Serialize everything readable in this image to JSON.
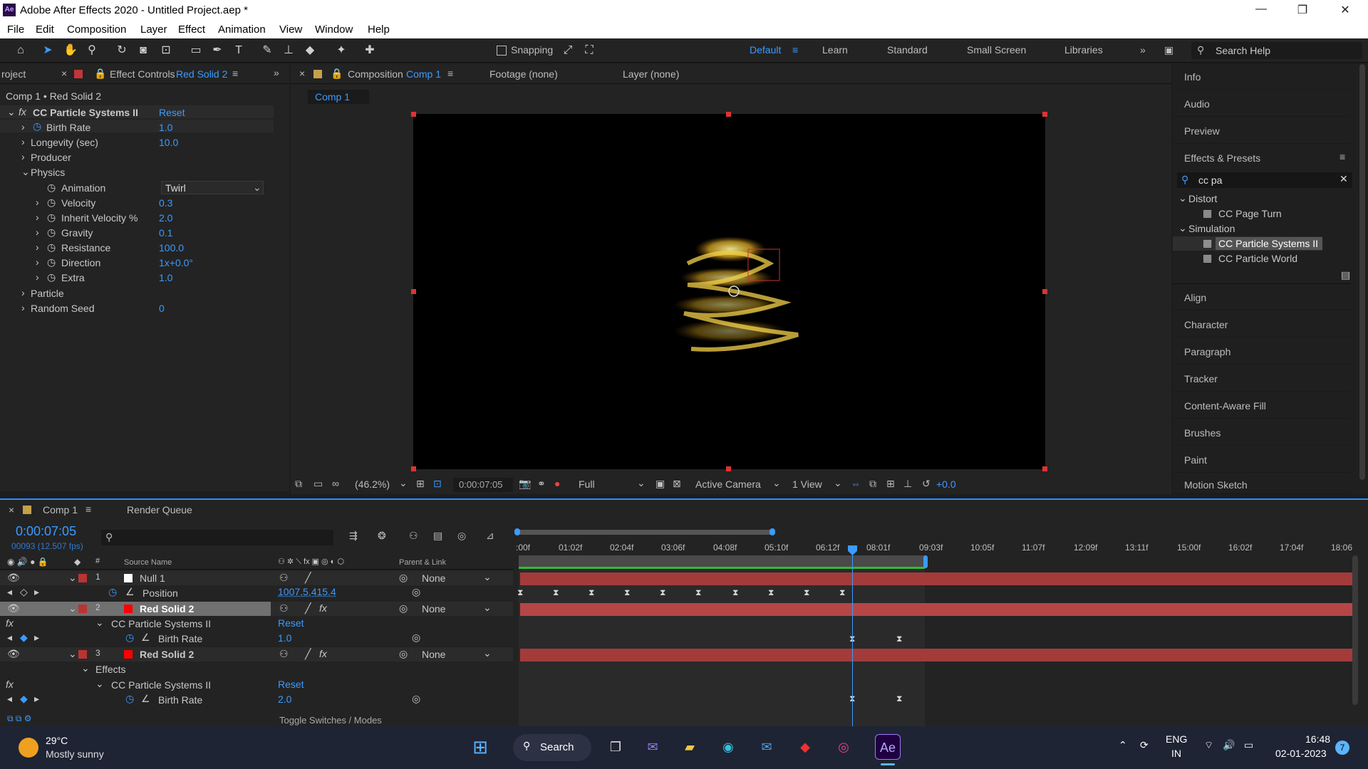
{
  "app": {
    "title": "Adobe After Effects 2020 - Untitled Project.aep *",
    "icon": "Ae"
  },
  "window_controls": [
    "—",
    "❐",
    "✕"
  ],
  "menu": [
    "File",
    "Edit",
    "Composition",
    "Layer",
    "Effect",
    "Animation",
    "View",
    "Window",
    "Help"
  ],
  "toolbar": {
    "snapping": "Snapping",
    "workspaces": [
      "Default",
      "Learn",
      "Standard",
      "Small Screen",
      "Libraries"
    ],
    "search_help": "Search Help"
  },
  "effect_controls": {
    "tab_project": "roject",
    "tab_label": "Effect Controls",
    "tab_layer": "Red Solid 2",
    "breadcrumb": "Comp 1 • Red Solid 2",
    "effect_name": "CC Particle Systems II",
    "reset": "Reset",
    "props": [
      {
        "name": "Birth Rate",
        "value": "1.0"
      },
      {
        "name": "Longevity (sec)",
        "value": "10.0"
      },
      {
        "name": "Producer",
        "value": ""
      },
      {
        "name": "Physics",
        "value": ""
      },
      {
        "name": "Animation",
        "value": "Twirl"
      },
      {
        "name": "Velocity",
        "value": "0.3"
      },
      {
        "name": "Inherit Velocity %",
        "value": "2.0"
      },
      {
        "name": "Gravity",
        "value": "0.1"
      },
      {
        "name": "Resistance",
        "value": "100.0"
      },
      {
        "name": "Direction",
        "value": "1x+0.0°"
      },
      {
        "name": "Extra",
        "value": "1.0"
      },
      {
        "name": "Particle",
        "value": ""
      },
      {
        "name": "Random Seed",
        "value": "0"
      }
    ]
  },
  "composition": {
    "tab_label": "Composition",
    "tab_comp": "Comp 1",
    "footage": "Footage  (none)",
    "layer": "Layer  (none)",
    "subtab": "Comp 1",
    "zoom": "(46.2%)",
    "timecode": "0:00:07:05",
    "resolution": "Full",
    "camera": "Active Camera",
    "views": "1 View",
    "exposure": "+0.0"
  },
  "right_panels": [
    "Info",
    "Audio",
    "Preview",
    "Effects & Presets",
    "Align",
    "Character",
    "Paragraph",
    "Tracker",
    "Content-Aware Fill",
    "Brushes",
    "Paint",
    "Motion Sketch"
  ],
  "effects_presets": {
    "search": "cc pa",
    "groups": [
      {
        "name": "Distort",
        "items": [
          "CC Page Turn"
        ]
      },
      {
        "name": "Simulation",
        "items": [
          "CC Particle Systems II",
          "CC Particle World"
        ]
      }
    ]
  },
  "timeline": {
    "tab_comp": "Comp 1",
    "tab_render": "Render Queue",
    "timecode": "0:00:07:05",
    "frame_info": "00093 (12.507 fps)",
    "col_source": "Source Name",
    "col_parent": "Parent & Link",
    "ruler": [
      ":00f",
      "01:02f",
      "02:04f",
      "03:06f",
      "04:08f",
      "05:10f",
      "06:12f",
      "08:01f",
      "09:03f",
      "10:05f",
      "11:07f",
      "12:09f",
      "13:11f",
      "15:00f",
      "16:02f",
      "17:04f",
      "18:06"
    ],
    "rows": [
      {
        "num": "1",
        "name": "Null 1",
        "parent": "None",
        "kind": "layer"
      },
      {
        "name": "Position",
        "value": "1007.5,415.4",
        "kind": "prop"
      },
      {
        "num": "2",
        "name": "Red Solid 2",
        "parent": "None",
        "kind": "layer"
      },
      {
        "name": "CC Particle Systems II",
        "value": "Reset",
        "kind": "effect"
      },
      {
        "name": "Birth Rate",
        "value": "1.0",
        "kind": "prop"
      },
      {
        "num": "3",
        "name": "Red Solid 2",
        "parent": "None",
        "kind": "layer"
      },
      {
        "name": "Effects",
        "kind": "group"
      },
      {
        "name": "CC Particle Systems II",
        "value": "Reset",
        "kind": "effect"
      },
      {
        "name": "Birth Rate",
        "value": "2.0",
        "kind": "prop"
      }
    ],
    "toggle": "Toggle Switches / Modes"
  },
  "taskbar": {
    "temp": "29°C",
    "weather": "Mostly sunny",
    "search": "Search",
    "lang1": "ENG",
    "lang2": "IN",
    "time": "16:48",
    "date": "02-01-2023",
    "badge": "7"
  }
}
